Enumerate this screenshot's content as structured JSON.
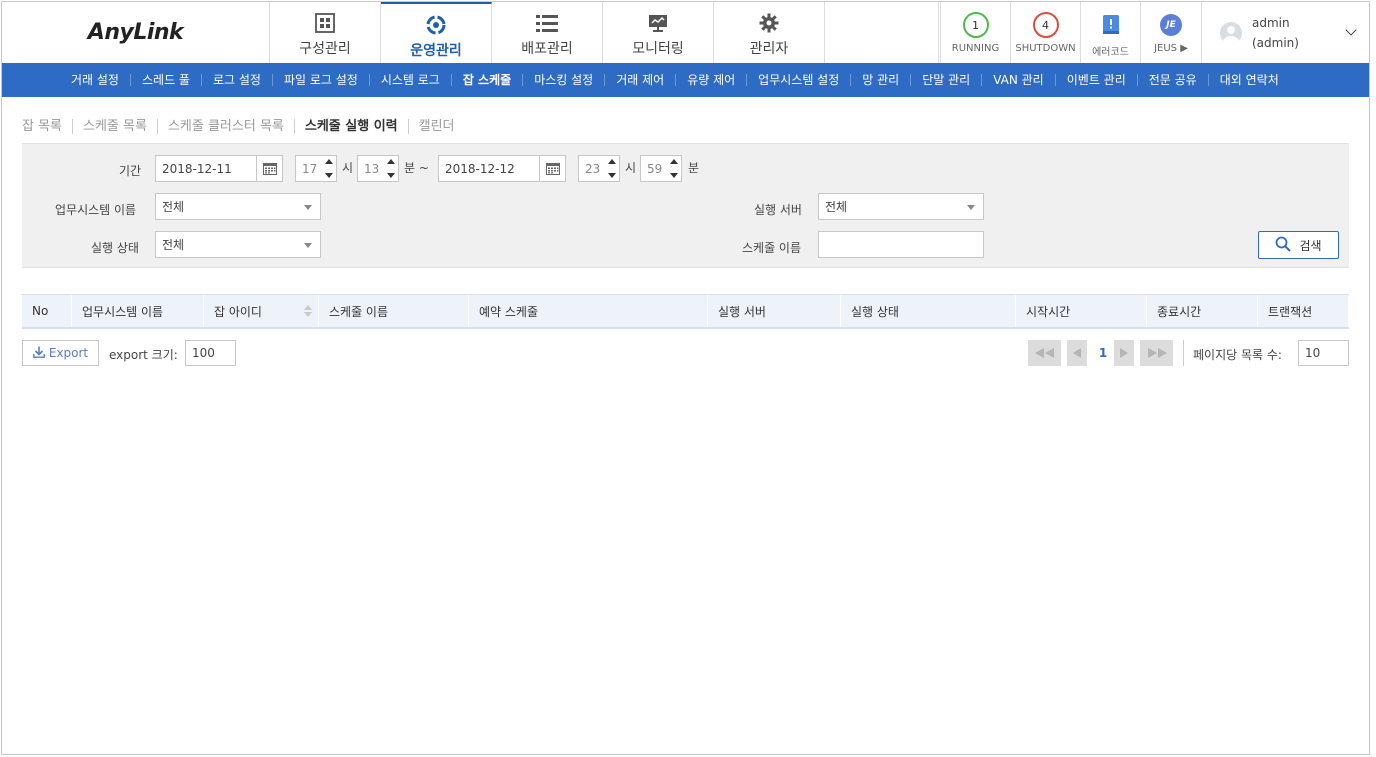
{
  "app": {
    "logo": "AnyLink"
  },
  "mainnav": [
    {
      "label": "구성관리",
      "icon": "grid-icon"
    },
    {
      "label": "운영관리",
      "icon": "operation-icon",
      "active": true
    },
    {
      "label": "배포관리",
      "icon": "list-icon"
    },
    {
      "label": "모니터링",
      "icon": "monitor-icon"
    },
    {
      "label": "관리자",
      "icon": "gear-icon"
    }
  ],
  "status": {
    "running_count": "1",
    "running_label": "RUNNING",
    "shutdown_count": "4",
    "shutdown_label": "SHUTDOWN",
    "errorcode_label": "에러코드",
    "jeus_badge": "JE",
    "jeus_label": "JEUS ▶"
  },
  "user": {
    "name": "admin",
    "role": "(admin)"
  },
  "subnav": [
    "거래 설정",
    "스레드 풀",
    "로그 설정",
    "파일 로그 설정",
    "시스템 로그",
    "잡 스케줄",
    "마스킹 설정",
    "거래 제어",
    "유량 제어",
    "업무시스템 설정",
    "망 관리",
    "단말 관리",
    "VAN 관리",
    "이벤트 관리",
    "전문 공유",
    "대외 연락처"
  ],
  "subnav_active": "잡 스케줄",
  "tabs": [
    "잡 목록",
    "스케줄 목록",
    "스케줄 클러스터 목록",
    "스케줄 실행 이력",
    "캘린더"
  ],
  "tabs_active": "스케줄 실행 이력",
  "search": {
    "period_label": "기간",
    "start_date": "2018-12-11",
    "start_hour": "17",
    "start_min": "13",
    "hour_unit": "시",
    "min_unit_tilde": "분 ~",
    "end_date": "2018-12-12",
    "end_hour": "23",
    "end_min": "59",
    "min_unit": "분",
    "system_label": "업무시스템 이름",
    "system_value": "전체",
    "server_label": "실행 서버",
    "server_value": "전체",
    "state_label": "실행 상태",
    "state_value": "전체",
    "schedule_label": "스케줄 이름",
    "schedule_value": "",
    "search_button": "검색"
  },
  "table": {
    "columns": [
      "No",
      "업무시스템 이름",
      "잡 아이디",
      "스케줄 이름",
      "예약 스케줄",
      "실행 서버",
      "실행 상태",
      "시작시간",
      "종료시간",
      "트랜잭션"
    ],
    "rows": []
  },
  "footer": {
    "export_label": "Export",
    "export_size_label": "export 크기:",
    "export_size": "100",
    "current_page": "1",
    "per_page_label": "페이지당 목록 수:",
    "per_page": "10"
  },
  "colors": {
    "accent": "#2e6bc4",
    "running": "#4fb94f",
    "shutdown": "#e04a3f"
  }
}
